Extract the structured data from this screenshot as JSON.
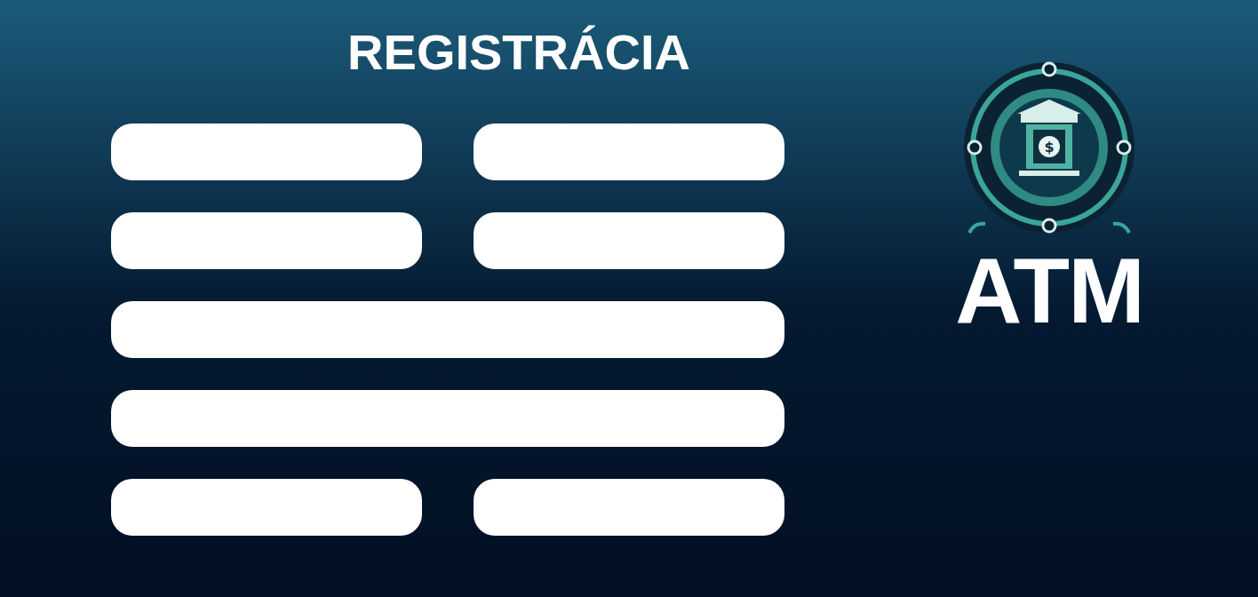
{
  "title": "REGISTRÁCIA",
  "fields": [
    {
      "kind": "half"
    },
    {
      "kind": "half"
    },
    {
      "kind": "half"
    },
    {
      "kind": "half"
    },
    {
      "kind": "full"
    },
    {
      "kind": "full"
    },
    {
      "kind": "half"
    },
    {
      "kind": "half"
    }
  ],
  "logo": {
    "text": "ATM"
  }
}
